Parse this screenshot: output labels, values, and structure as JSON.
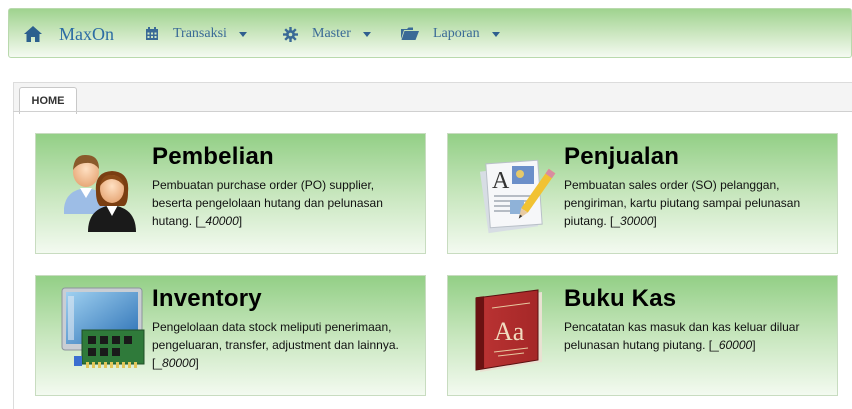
{
  "navbar": {
    "brand": "MaxOn",
    "menus": [
      {
        "label": "Transaksi",
        "icon": "calendar-icon"
      },
      {
        "label": "Master",
        "icon": "gear-icon"
      },
      {
        "label": "Laporan",
        "icon": "folder-icon"
      }
    ]
  },
  "tabs": [
    {
      "label": "HOME",
      "active": true
    }
  ],
  "cards": [
    {
      "title": "Pembelian",
      "desc": "Pembuatan purchase order (PO) supplier, beserta pengelolaan hutang dan pelunasan hutang. [_",
      "code": "40000",
      "close": "]",
      "icon": "users-icon"
    },
    {
      "title": "Penjualan",
      "desc": "Pembuatan sales order (SO) pelanggan, pengiriman, kartu piutang sampai pelunasan piutang. [_",
      "code": "30000",
      "close": "]",
      "icon": "document-pen-icon"
    },
    {
      "title": "Inventory",
      "desc": "Pengelolaan data stock meliputi penerimaan, pengeluaran, transfer, adjustment dan lainnya. [_",
      "code": "80000",
      "close": "]",
      "icon": "computer-board-icon"
    },
    {
      "title": "Buku Kas",
      "desc": "Pencatatan kas masuk dan kas keluar diluar pelunasan hutang piutang. [_",
      "code": "60000",
      "close": "]",
      "icon": "dictionary-book-icon"
    }
  ],
  "colors": {
    "nav_text": "#3a6a96",
    "card_green": "#93cf86"
  }
}
